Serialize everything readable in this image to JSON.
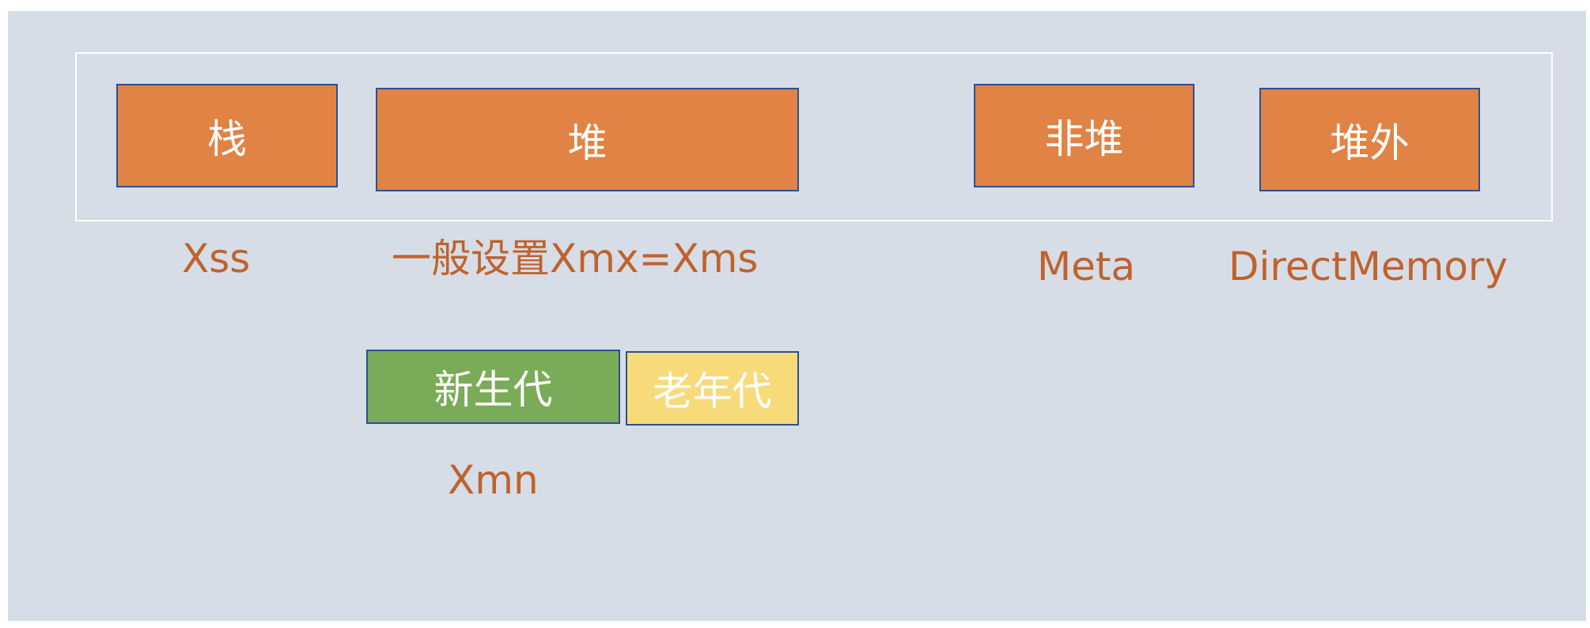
{
  "diagram": {
    "boxes": {
      "stack": "栈",
      "heap": "堆",
      "non_heap": "非堆",
      "off_heap": "堆外",
      "young_gen": "新生代",
      "old_gen": "老年代"
    },
    "labels": {
      "xss": "Xss",
      "heap_setting": "一般设置Xmx=Xms",
      "meta": "Meta",
      "direct_memory": "DirectMemory",
      "xmn": "Xmn"
    },
    "colors": {
      "background": "#d6dde6",
      "box_orange": "#e08344",
      "box_green": "#7aab58",
      "box_yellow": "#f7db7b",
      "box_border": "#2f4f8f",
      "label_text": "#c0622d",
      "frame": "#ffffff"
    }
  }
}
